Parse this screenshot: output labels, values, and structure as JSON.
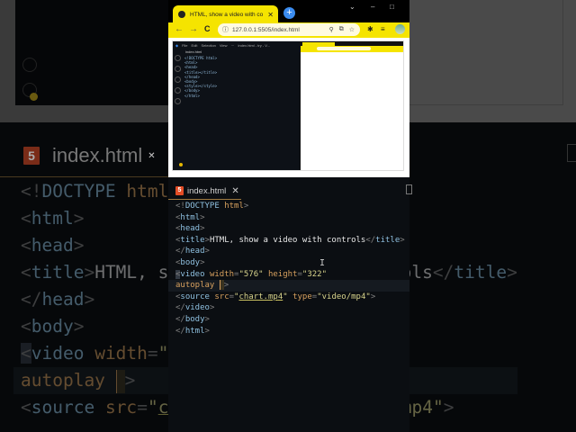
{
  "browser": {
    "tab_title": "HTML, show a video with controls",
    "new_tab": "+",
    "window_controls": {
      "dropdown": "⌄",
      "minimize": "–",
      "maximize": "□"
    },
    "nav": {
      "back": "←",
      "forward": "→",
      "reload": "C"
    },
    "url": "127.0.0.1:5505/index.html",
    "icons": [
      "info-icon",
      "zoom-icon",
      "share-icon",
      "star-icon",
      "extensions-icon",
      "reading-list-icon",
      "profile-avatar"
    ]
  },
  "inner_vscode": {
    "menu": [
      "File",
      "Edit",
      "Selection",
      "View",
      "···",
      "index.html - try - V..."
    ],
    "tab": "index.html",
    "code": [
      "<!DOCTYPE html>",
      "<html>",
      "<head>",
      "<title></title>",
      "</head>",
      "<body>",
      "<style></style>",
      "</body>",
      "</html>"
    ]
  },
  "editor": {
    "tab": "index.html",
    "close": "✕",
    "icon": "5",
    "lines": {
      "l1": {
        "a": "<!",
        "b": "DOCTYPE",
        "c": " html",
        "d": ">"
      },
      "l2": "html",
      "l3": "head",
      "l4": {
        "tag": "title",
        "text": "HTML, show a video with controls"
      },
      "l5": "head",
      "l6": "body",
      "l7": {
        "tag": "video",
        "a1": "width",
        "v1": "\"576\"",
        "a2": "height",
        "v2": "\"322\""
      },
      "l8": "autoplay",
      "l9": {
        "tag": "source",
        "a1": "src",
        "v1": "chart.mp4",
        "a2": "type",
        "v2": "\"video/mp4\""
      },
      "l10": "video",
      "l11": "body",
      "l12": "html"
    },
    "ibeam": "I"
  }
}
